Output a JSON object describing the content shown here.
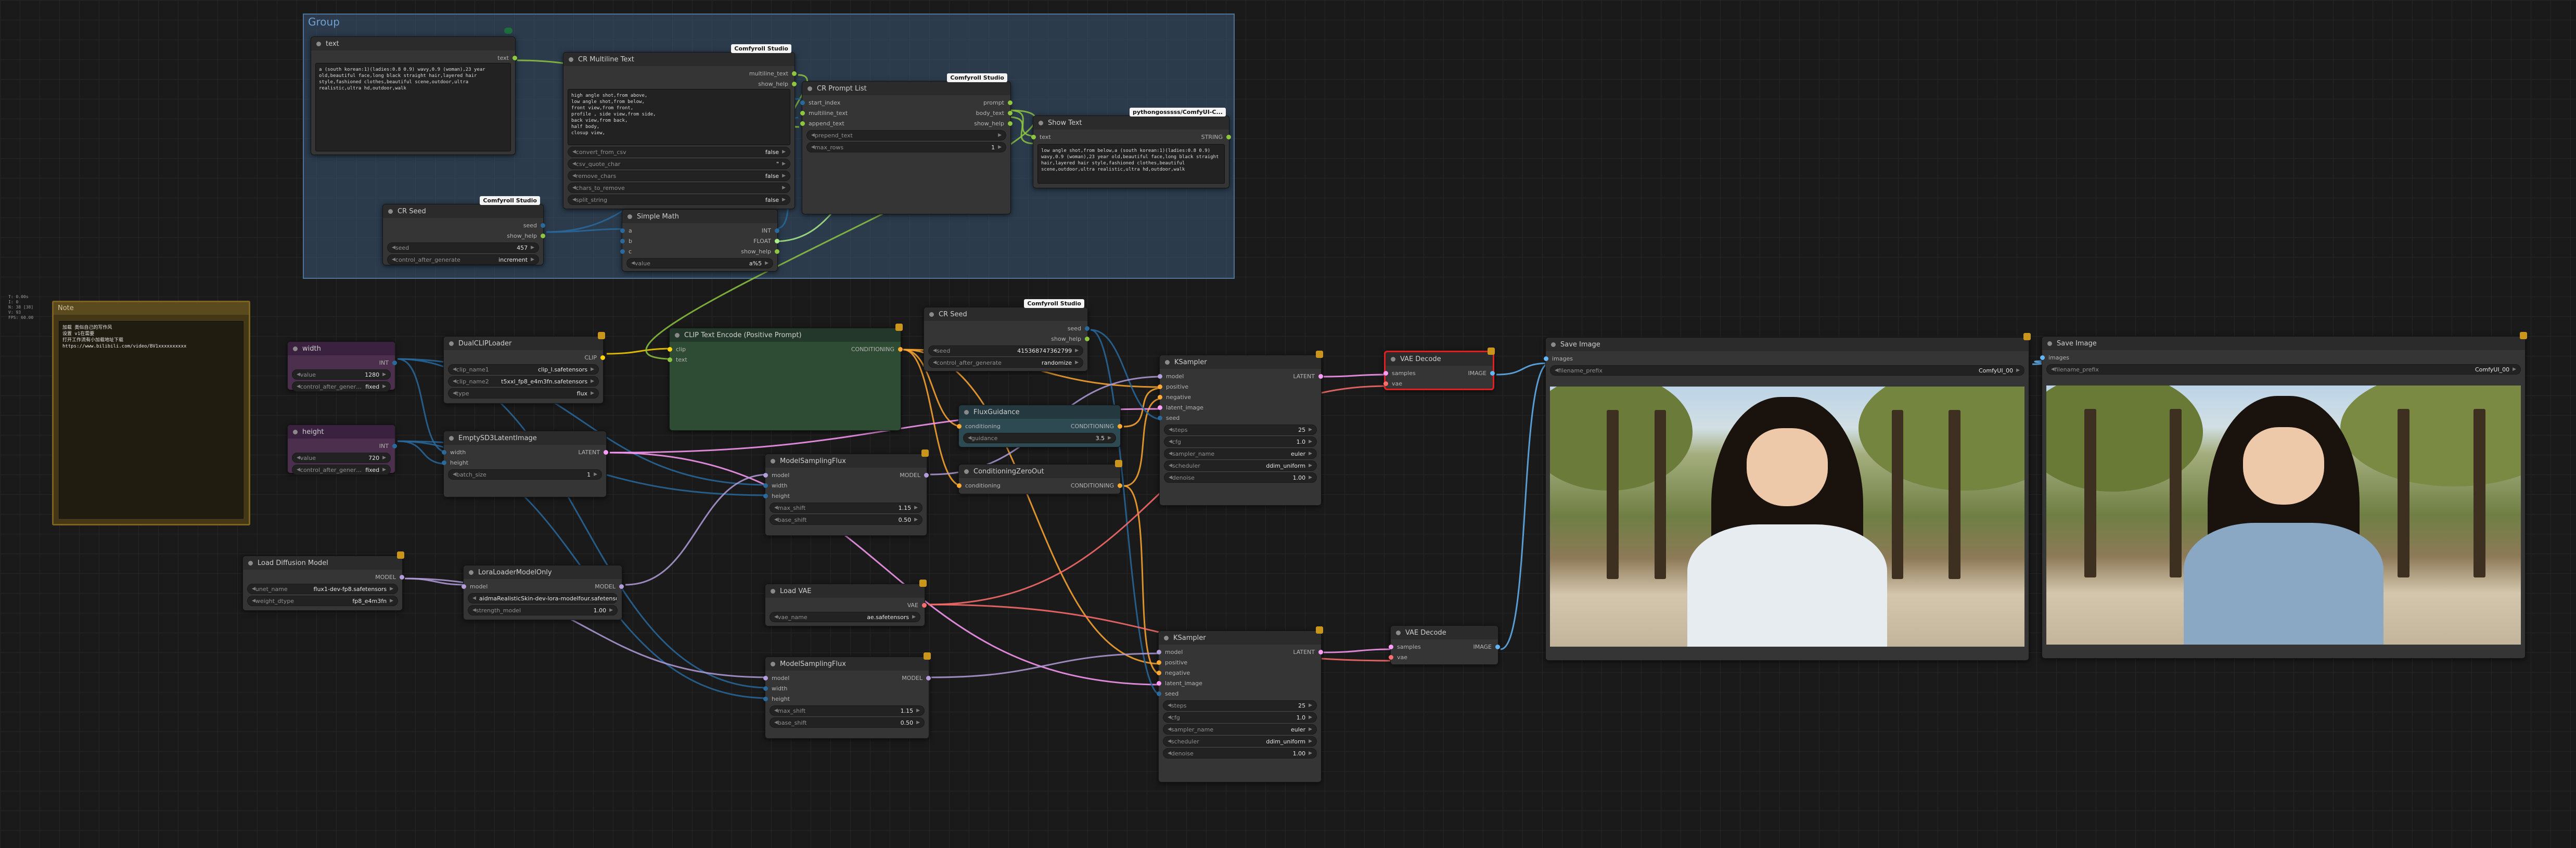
{
  "sidebar_info": "T: 0.00s\nI: 0\nN: 38 [38]\nV: 93\nFPS: 60.00",
  "group": {
    "title": "Group"
  },
  "colors": {
    "clip": "#ffd500",
    "conditioning": "#ffa931",
    "model": "#b39ddb",
    "vae": "#ff6e6e",
    "latent": "#ff9cf9",
    "image": "#64b5f6",
    "string": "#8ec63f",
    "int": "#29699c",
    "float": "#aaee88"
  },
  "nodes": {
    "text": {
      "title": "text",
      "out": "text",
      "content": "a (south korean:1)(ladies:0.8 0.9) wavy,0.9 (woman),23 year old,beautiful face,long black straight hair,layered hair style,fashioned clothes,beautiful scene,outdoor,ultra realistic,ultra hd,outdoor,walk"
    },
    "multiline": {
      "title": "CR Multiline Text",
      "badge": "Comfyroll Studio",
      "out1": "multiline_text",
      "out2": "show_help",
      "content": "high angle shot,from above,\nlow angle shot,from below,\nfront view,from front,\nprofile , side view,from side,\nback view,from back,\nhalf body,\nclosup view,",
      "widgets": [
        {
          "l": "convert_from_csv",
          "v": "false"
        },
        {
          "l": "csv_quote_char",
          "v": "\""
        },
        {
          "l": "remove_chars",
          "v": "false"
        },
        {
          "l": "chars_to_remove",
          "v": ""
        },
        {
          "l": "split_string",
          "v": "false"
        }
      ]
    },
    "promptlist": {
      "title": "CR Prompt List",
      "badge": "Comfyroll Studio",
      "in1": "start_index",
      "in2": "multiline_text",
      "in3": "append_text",
      "out1": "prompt",
      "out2": "body_text",
      "out3": "show_help",
      "widgets": [
        {
          "l": "prepend_text",
          "v": ""
        },
        {
          "l": "max_rows",
          "v": "1"
        }
      ]
    },
    "showtext": {
      "title": "Show Text",
      "badge": "pythongosssss/ComfyUI-C...",
      "in1": "text",
      "out1": "STRING",
      "content": "low angle shot,from below,a (south korean:1)(ladies:0.8 0.9) wavy,0.9 (woman),23 year old,beautiful face,long black straight hair,layered hair style,fashioned clothes,beautiful scene,outdoor,ultra realistic,ultra hd,outdoor,walk"
    },
    "crseed1": {
      "title": "CR Seed",
      "badge": "Comfyroll Studio",
      "out1": "seed",
      "out2": "show_help",
      "widgets": [
        {
          "l": "seed",
          "v": "457"
        },
        {
          "l": "control_after_generate",
          "v": "increment"
        }
      ]
    },
    "simplemath": {
      "title": "Simple Math",
      "in1": "a",
      "in2": "b",
      "in3": "c",
      "out1": "INT",
      "out2": "FLOAT",
      "out3": "show_help",
      "widgets": [
        {
          "l": "value",
          "v": "a%5"
        }
      ]
    },
    "width": {
      "title": "width",
      "out1": "INT",
      "widgets": [
        {
          "l": "value",
          "v": "1280"
        },
        {
          "l": "control_after_generate",
          "v": "fixed"
        }
      ]
    },
    "height": {
      "title": "height",
      "out1": "INT",
      "widgets": [
        {
          "l": "value",
          "v": "720"
        },
        {
          "l": "control_after_generate",
          "v": "fixed"
        }
      ]
    },
    "dualclip": {
      "title": "DualCLIPLoader",
      "out1": "CLIP",
      "widgets": [
        {
          "l": "clip_name1",
          "v": "clip_l.safetensors"
        },
        {
          "l": "clip_name2",
          "v": "t5xxl_fp8_e4m3fn.safetensors"
        },
        {
          "l": "type",
          "v": "flux"
        }
      ]
    },
    "cliptext": {
      "title": "CLIP Text Encode (Positive Prompt)",
      "in1": "clip",
      "in2": "text",
      "out1": "CONDITIONING"
    },
    "crseed2": {
      "title": "CR Seed",
      "badge": "Comfyroll Studio",
      "out1": "seed",
      "out2": "show_help",
      "widgets": [
        {
          "l": "seed",
          "v": "415368747362799"
        },
        {
          "l": "control_after_generate",
          "v": "randomize"
        }
      ]
    },
    "emptylatent": {
      "title": "EmptySD3LatentImage",
      "in1": "width",
      "in2": "height",
      "out1": "LATENT",
      "widgets": [
        {
          "l": "batch_size",
          "v": "1"
        }
      ]
    },
    "fluxguidance": {
      "title": "FluxGuidance",
      "in1": "conditioning",
      "out1": "CONDITIONING",
      "widgets": [
        {
          "l": "guidance",
          "v": "3.5"
        }
      ]
    },
    "condzero": {
      "title": "ConditioningZeroOut",
      "in1": "conditioning",
      "out1": "CONDITIONING"
    },
    "msf1": {
      "title": "ModelSamplingFlux",
      "in1": "model",
      "in2": "width",
      "in3": "height",
      "out1": "MODEL",
      "widgets": [
        {
          "l": "max_shift",
          "v": "1.15"
        },
        {
          "l": "base_shift",
          "v": "0.50"
        }
      ]
    },
    "ksampler1": {
      "title": "KSampler",
      "in1": "model",
      "in2": "positive",
      "in3": "negative",
      "in4": "latent_image",
      "in5": "seed",
      "out1": "LATENT",
      "widgets": [
        {
          "l": "steps",
          "v": "25"
        },
        {
          "l": "cfg",
          "v": "1.0"
        },
        {
          "l": "sampler_name",
          "v": "euler"
        },
        {
          "l": "scheduler",
          "v": "ddim_uniform"
        },
        {
          "l": "denoise",
          "v": "1.00"
        }
      ]
    },
    "vaedecode1": {
      "title": "VAE Decode",
      "in1": "samples",
      "in2": "vae",
      "out1": "IMAGE"
    },
    "saveimage1": {
      "title": "Save Image",
      "in1": "images",
      "widgets": [
        {
          "l": "filename_prefix",
          "v": "ComfyUI_00"
        }
      ]
    },
    "saveimage2": {
      "title": "Save Image",
      "in1": "images",
      "widgets": [
        {
          "l": "filename_prefix",
          "v": "ComfyUI_00"
        }
      ]
    },
    "loaddiff": {
      "title": "Load Diffusion Model",
      "out1": "MODEL",
      "widgets": [
        {
          "l": "unet_name",
          "v": "flux1-dev-fp8.safetensors"
        },
        {
          "l": "weight_dtype",
          "v": "fp8_e4m3fn"
        }
      ]
    },
    "lora": {
      "title": "LoraLoaderModelOnly",
      "in1": "model",
      "out1": "MODEL",
      "widgets": [
        {
          "l": "lora_name",
          "v": "aidmaRealisticSkin-dev-lora-modelfour.safetensors"
        },
        {
          "l": "strength_model",
          "v": "1.00"
        }
      ]
    },
    "loadvae": {
      "title": "Load VAE",
      "out1": "VAE",
      "widgets": [
        {
          "l": "vae_name",
          "v": "ae.safetensors"
        }
      ]
    },
    "msf2": {
      "title": "ModelSamplingFlux",
      "in1": "model",
      "in2": "width",
      "in3": "height",
      "out1": "MODEL",
      "widgets": [
        {
          "l": "max_shift",
          "v": "1.15"
        },
        {
          "l": "base_shift",
          "v": "0.50"
        }
      ]
    },
    "ksampler2": {
      "title": "KSampler",
      "in1": "model",
      "in2": "positive",
      "in3": "negative",
      "in4": "latent_image",
      "in5": "seed",
      "out1": "LATENT",
      "widgets": [
        {
          "l": "steps",
          "v": "25"
        },
        {
          "l": "cfg",
          "v": "1.0"
        },
        {
          "l": "sampler_name",
          "v": "euler"
        },
        {
          "l": "scheduler",
          "v": "ddim_uniform"
        },
        {
          "l": "denoise",
          "v": "1.00"
        }
      ]
    },
    "vaedecode2": {
      "title": "VAE Decode",
      "in1": "samples",
      "in2": "vae",
      "out1": "IMAGE"
    },
    "note": {
      "title": "Note",
      "content": "加载 类似自己的写作风\n设置 v1在需要\n打开工作流有小加载地址下载\nhttps://www.bilibili.com/video/BV1xxxxxxxxxx"
    }
  }
}
